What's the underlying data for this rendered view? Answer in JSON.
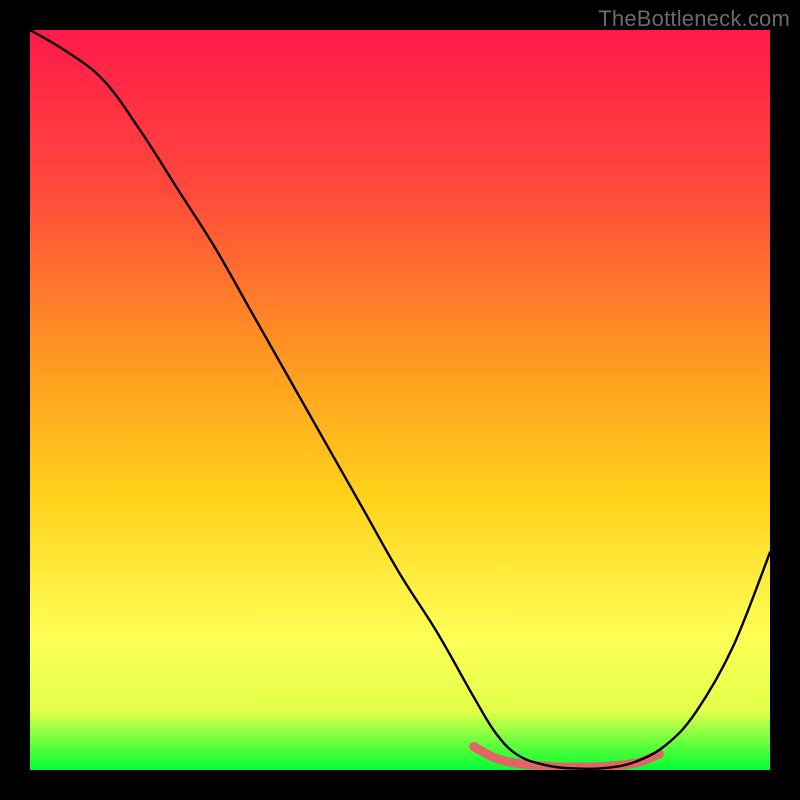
{
  "watermark": "TheBottleneck.com",
  "chart_data": {
    "type": "line",
    "title": "",
    "xlabel": "",
    "ylabel": "",
    "xlim": [
      0,
      100
    ],
    "ylim": [
      0,
      102
    ],
    "grid": false,
    "legend": false,
    "background_gradient": {
      "top_color": "#ff1a4b",
      "mid_upper_color": "#ff6a2f",
      "mid_color": "#ffd21a",
      "mid_lower_color": "#ffff55",
      "bottom_color": "#00ff33"
    },
    "series": [
      {
        "name": "bottleneck-curve",
        "x": [
          0,
          5,
          10,
          15,
          20,
          25,
          30,
          35,
          40,
          45,
          50,
          55,
          60,
          63,
          66,
          70,
          74,
          78,
          82,
          86,
          90,
          95,
          100
        ],
        "y": [
          102,
          99,
          95,
          88,
          80,
          72,
          63,
          54,
          45,
          36,
          27,
          19,
          10,
          5,
          2,
          0.6,
          0.2,
          0.3,
          1.2,
          3.5,
          8,
          17,
          30
        ],
        "color": "#000000",
        "width": 2.4
      }
    ],
    "highlight_band": {
      "name": "optimal-zone",
      "x": [
        60,
        63,
        66,
        70,
        74,
        78,
        82,
        85
      ],
      "y": [
        3.2,
        1.6,
        0.9,
        0.5,
        0.4,
        0.5,
        1.0,
        2.2
      ],
      "color": "#e06666",
      "width": 9,
      "dot_radius": 4.8,
      "end_dots_x": [
        60,
        85
      ],
      "end_dots_y": [
        3.2,
        2.2
      ]
    }
  }
}
